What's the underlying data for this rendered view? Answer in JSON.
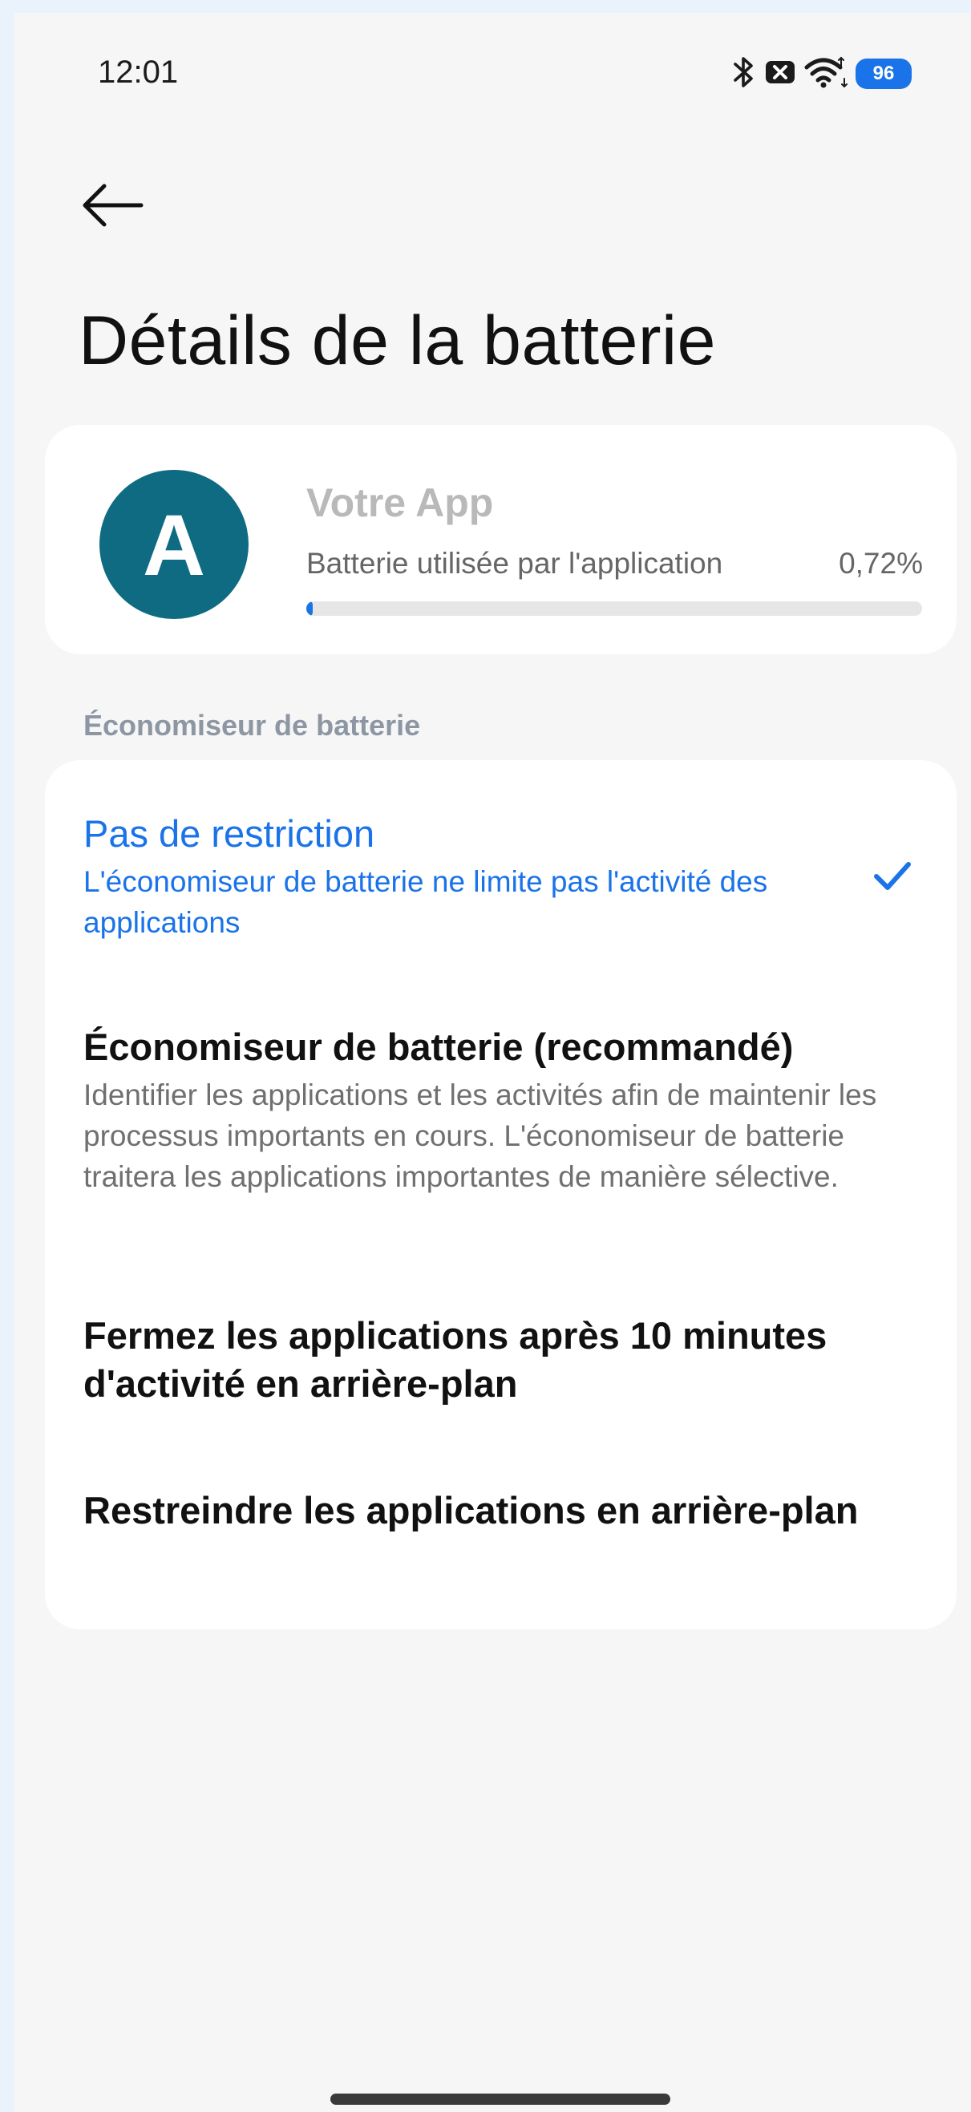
{
  "status_bar": {
    "time": "12:01",
    "battery_level": "96",
    "icons": [
      "bluetooth-icon",
      "notification-off-icon",
      "wifi-icon",
      "battery-icon"
    ]
  },
  "header": {
    "back_icon": "arrow-left-icon",
    "title": "Détails de la batterie"
  },
  "app_card": {
    "avatar_letter": "A",
    "avatar_color": "#0e6b82",
    "app_name": "Votre App",
    "usage_label": "Batterie utilisée par l'application",
    "usage_value": "0,72%",
    "usage_percent": 0.72
  },
  "battery_saver": {
    "section_title": "Économiseur de batterie",
    "options": [
      {
        "title": "Pas de restriction",
        "description": "L'économiseur de batterie ne limite pas l'activité des applications",
        "selected": true
      },
      {
        "title": "Économiseur de batterie (recommandé)",
        "description": "Identifier les applications et les activités afin de maintenir les processus importants en cours. L'économiseur de batterie traitera les applications importantes de manière sélective.",
        "selected": false
      },
      {
        "title": "Fermez les applications après 10 minutes d'activité en arrière-plan",
        "description": "",
        "selected": false
      },
      {
        "title": "Restreindre les applications en arrière-plan",
        "description": "",
        "selected": false
      }
    ]
  },
  "colors": {
    "accent": "#1a73e8",
    "background": "#f6f6f6",
    "card": "#ffffff"
  }
}
